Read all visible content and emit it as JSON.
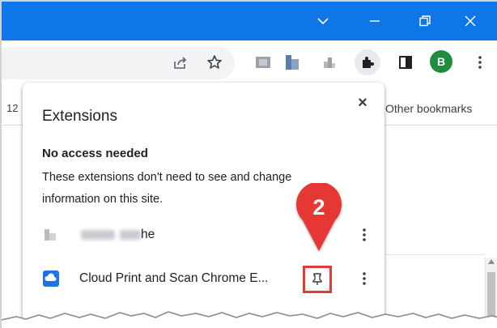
{
  "toolbar": {
    "avatar_letter": "B"
  },
  "bookmarks": {
    "partial_left": "12",
    "other_bookmarks": "Other bookmarks"
  },
  "popup": {
    "title": "Extensions",
    "close_label": "×",
    "section_heading": "No access needed",
    "section_description": "These extensions don't need to see and change information on this site.",
    "extensions": [
      {
        "name": "he",
        "icon": "blurred-extension-icon",
        "pinned": false
      },
      {
        "name": "Cloud Print and Scan Chrome E...",
        "icon": "cloud-print-icon",
        "pinned": false
      }
    ]
  },
  "callout": {
    "number": "2",
    "color": "#e53935"
  },
  "colors": {
    "titlebar": "#0f76e8",
    "accent_red": "#e53935",
    "avatar": "#1e8e3e"
  }
}
